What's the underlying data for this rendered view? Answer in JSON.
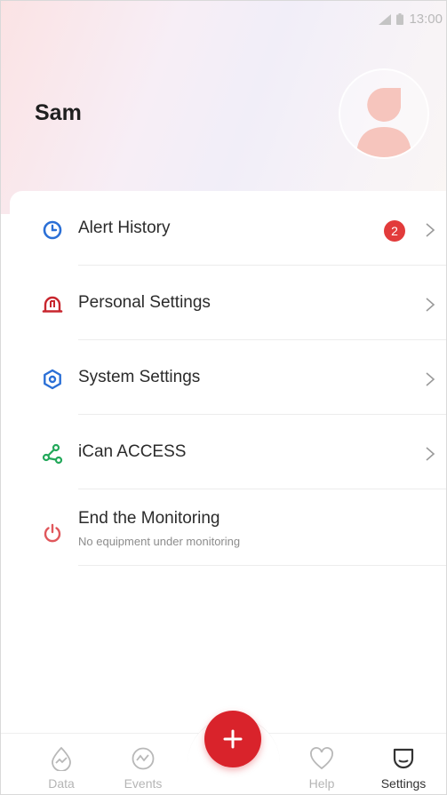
{
  "status_bar": {
    "time": "13:00"
  },
  "profile": {
    "name": "Sam"
  },
  "menu": {
    "items": [
      {
        "label": "Alert History",
        "icon": "clock-icon",
        "badge": "2",
        "color": "#2a6fd6"
      },
      {
        "label": "Personal Settings",
        "icon": "helmet-icon",
        "color": "#c8262e"
      },
      {
        "label": "System Settings",
        "icon": "settings-icon",
        "color": "#2a6fd6"
      },
      {
        "label": "iCan ACCESS",
        "icon": "share-nodes-icon",
        "color": "#23a85a"
      },
      {
        "label": "End the Monitoring",
        "sublabel": "No equipment under monitoring",
        "icon": "power-icon",
        "color": "#e0575c"
      }
    ]
  },
  "tabbar": {
    "tabs": [
      {
        "label": "Data",
        "icon": "drop-chart-icon"
      },
      {
        "label": "Events",
        "icon": "wave-circle-icon"
      },
      {
        "label": "Help",
        "icon": "heart-icon"
      },
      {
        "label": "Settings",
        "icon": "chat-bubble-icon",
        "active": true
      }
    ],
    "fab_icon": "plus-icon",
    "fab_color": "#d9232b"
  }
}
